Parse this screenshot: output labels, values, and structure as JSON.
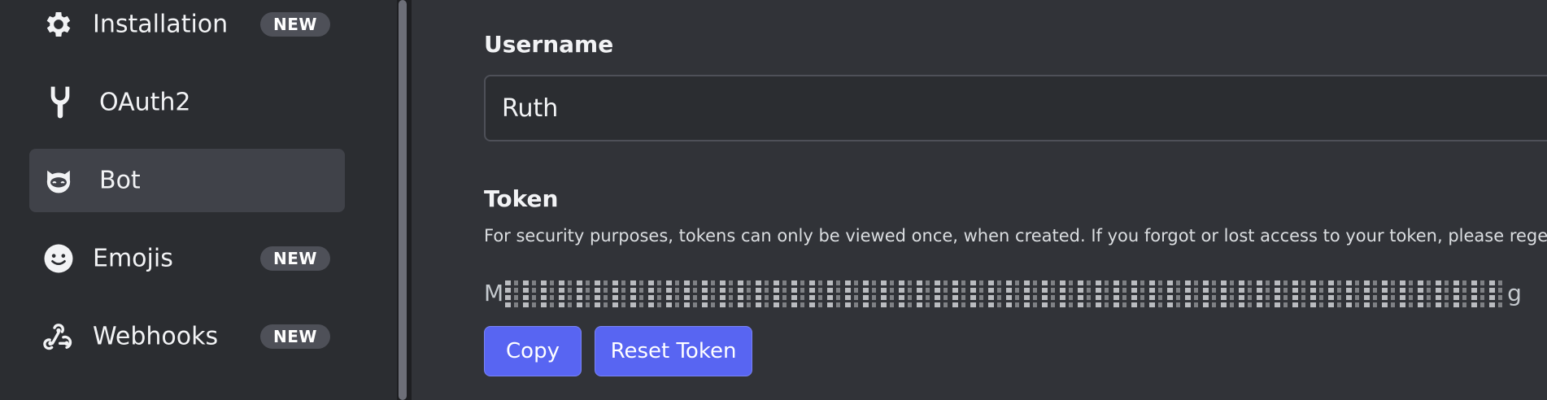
{
  "sidebar": {
    "items": [
      {
        "label": "Installation",
        "icon": "gear-icon",
        "badge": "NEW",
        "active": false
      },
      {
        "label": "OAuth2",
        "icon": "wrench-icon",
        "badge": "",
        "active": false
      },
      {
        "label": "Bot",
        "icon": "bot-icon",
        "badge": "",
        "active": true
      },
      {
        "label": "Emojis",
        "icon": "smiley-icon",
        "badge": "NEW",
        "active": false
      },
      {
        "label": "Webhooks",
        "icon": "webhook-icon",
        "badge": "NEW",
        "active": false
      }
    ]
  },
  "main": {
    "username_label": "Username",
    "username_value": "Ruth",
    "token_label": "Token",
    "token_description": "For security purposes, tokens can only be viewed once, when created. If you forgot or lost access to your token, please regenerate",
    "token_prefix": "M",
    "token_suffix": "g",
    "copy_label": "Copy",
    "reset_label": "Reset Token"
  },
  "colors": {
    "accent": "#5865f2",
    "sidebar_bg": "#2b2d31",
    "main_bg": "#313338",
    "active_bg": "#404249",
    "badge_bg": "#4e5058"
  }
}
